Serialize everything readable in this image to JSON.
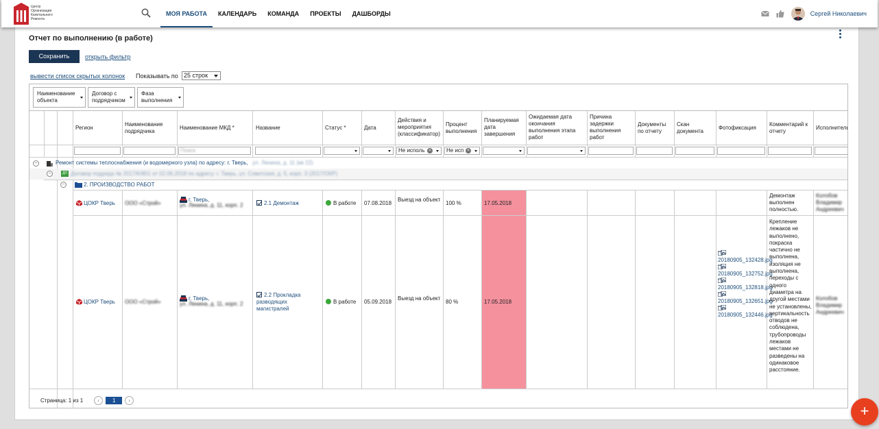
{
  "app": {
    "logo_text": "Центр Организации Капитального Ремонта",
    "nav": [
      "МОЯ РАБОТА",
      "КАЛЕНДАРЬ",
      "КОМАНДА",
      "ПРОЕКТЫ",
      "ДАШБОРДЫ"
    ],
    "user_name": "Сергей Николаевич"
  },
  "page": {
    "title": "Отчет по выполнению (в работе)",
    "save_label": "Сохранить",
    "filter_link": "открыть фильтр",
    "hidden_cols_link": "вывести список скрытых колонок",
    "show_label": "Показывать по",
    "rows_value": "25 строк"
  },
  "group_chips": [
    "Наименование объекта",
    "Договор с подрядчиком",
    "Фаза выполнения"
  ],
  "columns": [
    "Регион",
    "Наименование подрядчика",
    "Наименование МКД *",
    "Название",
    "Статус *",
    "Дата",
    "Действия и мероприятия (классификатор)",
    "Процент выполнения",
    "Планируемая дата завершения",
    "Ожидаемая дата окончания выполнения этапа работ",
    "Причина задержки выполнения работ",
    "Документы по отчету",
    "Скан документа",
    "Фотофиксация",
    "Комментарий к отчету",
    "Исполнитель"
  ],
  "filters": {
    "actions": "Не исполь",
    "percent": "Не исп"
  },
  "groups": {
    "object": "Ремонт системы теплоснабжения (и водомерного узла) по адресу: г. Тверь,",
    "object_blur": "ул. Ленина, д. 11 (кв 22)",
    "contract_badge": "ДП",
    "contract_blur": "Договор подряда № 2017/К/801 от 02.06.2018 по адресу: г. Тверь, ул. Советская, д. 5, корп. 3 (2017/ОКР)",
    "phase": "2. ПРОИЗВОДСТВО РАБОТ"
  },
  "rows": [
    {
      "region": "ЦОКР Тверь",
      "contractor": "ООО «Строй»",
      "mkd_city": "г. Тверь,",
      "mkd_blur": "ул. Ленина, д. 11, корп. 2",
      "name": "2.1 Демонтаж",
      "status": "В работе",
      "date": "07.08.2018",
      "action": "Выезд на объект",
      "percent": "100 %",
      "planned": "17.05.2018",
      "photos": [],
      "comment": "Демонтаж выполнен полностью.",
      "executor": "Колобов Владимир Андреевич"
    },
    {
      "region": "ЦОКР Тверь",
      "contractor": "ООО «Строй»",
      "mkd_city": "г. Тверь,",
      "mkd_blur": "ул. Ленина, д. 11, корп. 2",
      "name": "2.2 Прокладка разводящих магистралей",
      "status": "В работе",
      "date": "05.09.2018",
      "action": "Выезд на объект",
      "percent": "80 %",
      "planned": "17.05.2018",
      "photos": [
        "20180905_132428.jpg",
        "20180905_132752.jpg",
        "20180905_132818.jpg",
        "20180905_132651.jpg",
        "20180905_132446.jpg"
      ],
      "comment": "Крепление лежаков не выполнено, покраска частично не выполнена, изоляция не выполнена, переходы с одного диаметра на другой местами не установлены, вертикальность отводов не соблюдена, трубопроводы лежаков местами не разведены на одинаковое расстояние.",
      "executor": "Колобов Владимир Андреевич"
    }
  ],
  "pager": {
    "label": "Страница: 1 из 1",
    "current": "1"
  },
  "colors": {
    "primary": "#1b3554",
    "link": "#1d4e7c",
    "overdue": "#f4919d",
    "fab": "#e8401f",
    "status_ok": "#3ca83c"
  }
}
